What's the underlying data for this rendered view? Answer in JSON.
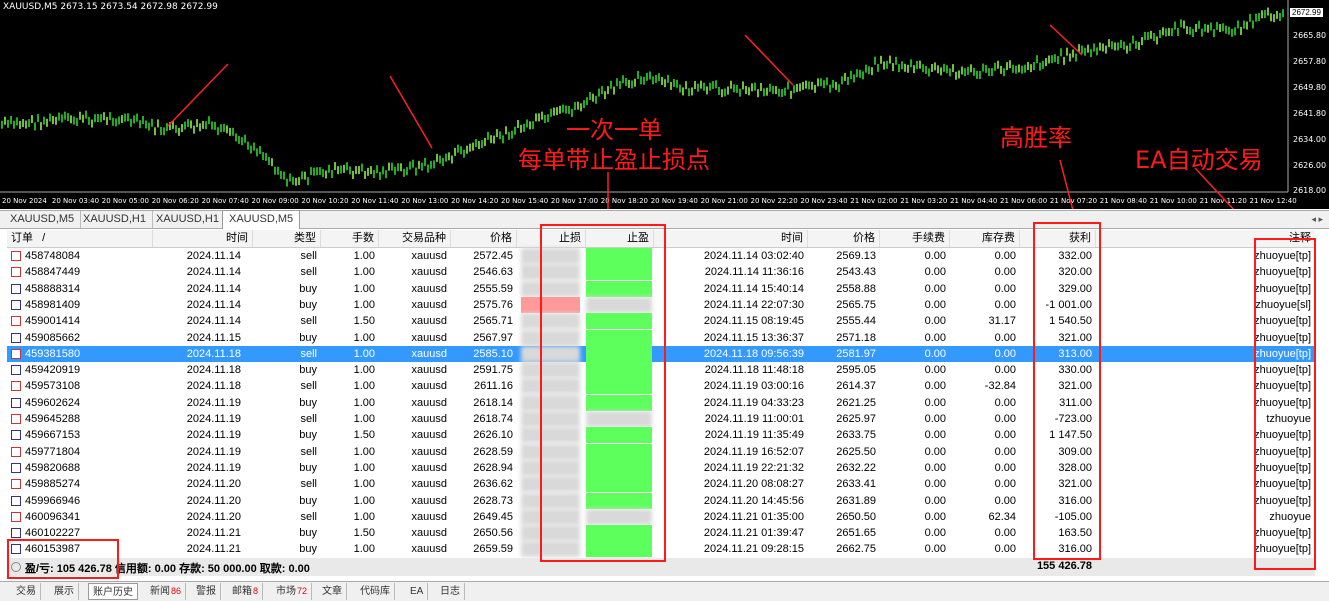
{
  "chart": {
    "title": "XAUUSD,M5  2673.15 2673.54 2672.98 2672.99",
    "current_price": "2672.99",
    "price_ticks": [
      "2665.80",
      "2657.80",
      "2649.80",
      "2641.80",
      "2634.00",
      "2626.00",
      "2618.00"
    ],
    "time_ticks": [
      "20 Nov 2024",
      "20 Nov 03:40",
      "20 Nov 05:00",
      "20 Nov 06:20",
      "20 Nov 07:40",
      "20 Nov 09:00",
      "20 Nov 10:20",
      "20 Nov 11:40",
      "20 Nov 13:00",
      "20 Nov 14:20",
      "20 Nov 15:40",
      "20 Nov 17:00",
      "20 Nov 18:20",
      "20 Nov 19:40",
      "20 Nov 21:00",
      "20 Nov 22:20",
      "20 Nov 23:40",
      "21 Nov 02:00",
      "21 Nov 03:20",
      "21 Nov 04:40",
      "21 Nov 06:00",
      "21 Nov 07:20",
      "21 Nov 08:40",
      "21 Nov 10:00",
      "21 Nov 11:20",
      "21 Nov 12:40"
    ],
    "annotations": {
      "line1": "一次一单",
      "line2": "每单带止盈止损点",
      "win_rate": "高胜率",
      "ea": "EA自动交易"
    },
    "accent": "#ff1a1a"
  },
  "chart_tabs": [
    "XAUUSD,M5",
    "XAUUSD,H1",
    "XAUUSD,H1",
    "XAUUSD,M5"
  ],
  "table": {
    "headers": {
      "order": "订单",
      "sort": "/",
      "time": "时间",
      "type": "类型",
      "lots": "手数",
      "symbol": "交易品种",
      "price": "价格",
      "sl": "止损",
      "tp": "止盈",
      "close_time": "时间",
      "close_price": "价格",
      "commission": "手续费",
      "swap": "库存费",
      "profit": "获利",
      "comment": "注释"
    },
    "rows": [
      {
        "order": "458748084",
        "time": "2024.11.14",
        "type": "sell",
        "lots": "1.00",
        "symbol": "xauusd",
        "price": "2572.45",
        "close_time": "2024.11.14 03:02:40",
        "close_price": "2569.13",
        "commission": "0.00",
        "swap": "0.00",
        "profit": "332.00",
        "comment": "zhuoyue[tp]",
        "result": "tp"
      },
      {
        "order": "458847449",
        "time": "2024.11.14",
        "type": "sell",
        "lots": "1.00",
        "symbol": "xauusd",
        "price": "2546.63",
        "close_time": "2024.11.14 11:36:16",
        "close_price": "2543.43",
        "commission": "0.00",
        "swap": "0.00",
        "profit": "320.00",
        "comment": "zhuoyue[tp]",
        "result": "tp"
      },
      {
        "order": "458888314",
        "time": "2024.11.14",
        "type": "buy",
        "lots": "1.00",
        "symbol": "xauusd",
        "price": "2555.59",
        "close_time": "2024.11.14 15:40:14",
        "close_price": "2558.88",
        "commission": "0.00",
        "swap": "0.00",
        "profit": "329.00",
        "comment": "zhuoyue[tp]",
        "result": "tp"
      },
      {
        "order": "458981409",
        "time": "2024.11.14",
        "type": "buy",
        "lots": "1.00",
        "symbol": "xauusd",
        "price": "2575.76",
        "close_time": "2024.11.14 22:07:30",
        "close_price": "2565.75",
        "commission": "0.00",
        "swap": "0.00",
        "profit": "-1 001.00",
        "comment": "zhuoyue[sl]",
        "result": "sl"
      },
      {
        "order": "459001414",
        "time": "2024.11.14",
        "type": "sell",
        "lots": "1.50",
        "symbol": "xauusd",
        "price": "2565.71",
        "close_time": "2024.11.15 08:19:45",
        "close_price": "2555.44",
        "commission": "0.00",
        "swap": "31.17",
        "profit": "1 540.50",
        "comment": "zhuoyue[tp]",
        "result": "tp"
      },
      {
        "order": "459085662",
        "time": "2024.11.15",
        "type": "buy",
        "lots": "1.00",
        "symbol": "xauusd",
        "price": "2567.97",
        "close_time": "2024.11.15 13:36:37",
        "close_price": "2571.18",
        "commission": "0.00",
        "swap": "0.00",
        "profit": "321.00",
        "comment": "zhuoyue[tp]",
        "result": "tp"
      },
      {
        "order": "459381580",
        "time": "2024.11.18",
        "type": "sell",
        "lots": "1.00",
        "symbol": "xauusd",
        "price": "2585.10",
        "close_time": "2024.11.18 09:56:39",
        "close_price": "2581.97",
        "commission": "0.00",
        "swap": "0.00",
        "profit": "313.00",
        "comment": "zhuoyue[tp]",
        "result": "tp",
        "selected": true
      },
      {
        "order": "459420919",
        "time": "2024.11.18",
        "type": "buy",
        "lots": "1.00",
        "symbol": "xauusd",
        "price": "2591.75",
        "close_time": "2024.11.18 11:48:18",
        "close_price": "2595.05",
        "commission": "0.00",
        "swap": "0.00",
        "profit": "330.00",
        "comment": "zhuoyue[tp]",
        "result": "tp"
      },
      {
        "order": "459573108",
        "time": "2024.11.18",
        "type": "sell",
        "lots": "1.00",
        "symbol": "xauusd",
        "price": "2611.16",
        "close_time": "2024.11.19 03:00:16",
        "close_price": "2614.37",
        "commission": "0.00",
        "swap": "-32.84",
        "profit": "321.00",
        "comment": "zhuoyue[tp]",
        "result": "tp"
      },
      {
        "order": "459602624",
        "time": "2024.11.19",
        "type": "buy",
        "lots": "1.00",
        "symbol": "xauusd",
        "price": "2618.14",
        "close_time": "2024.11.19 04:33:23",
        "close_price": "2621.25",
        "commission": "0.00",
        "swap": "0.00",
        "profit": "311.00",
        "comment": "zhuoyue[tp]",
        "result": "tp"
      },
      {
        "order": "459645288",
        "time": "2024.11.19",
        "type": "sell",
        "lots": "1.00",
        "symbol": "xauusd",
        "price": "2618.74",
        "close_time": "2024.11.19 11:00:01",
        "close_price": "2625.97",
        "commission": "0.00",
        "swap": "0.00",
        "profit": "-723.00",
        "comment": "tzhuoyue",
        "result": "none"
      },
      {
        "order": "459667153",
        "time": "2024.11.19",
        "type": "buy",
        "lots": "1.50",
        "symbol": "xauusd",
        "price": "2626.10",
        "close_time": "2024.11.19 11:35:49",
        "close_price": "2633.75",
        "commission": "0.00",
        "swap": "0.00",
        "profit": "1 147.50",
        "comment": "zhuoyue[tp]",
        "result": "tp"
      },
      {
        "order": "459771804",
        "time": "2024.11.19",
        "type": "sell",
        "lots": "1.00",
        "symbol": "xauusd",
        "price": "2628.59",
        "close_time": "2024.11.19 16:52:07",
        "close_price": "2625.50",
        "commission": "0.00",
        "swap": "0.00",
        "profit": "309.00",
        "comment": "zhuoyue[tp]",
        "result": "tp"
      },
      {
        "order": "459820688",
        "time": "2024.11.19",
        "type": "buy",
        "lots": "1.00",
        "symbol": "xauusd",
        "price": "2628.94",
        "close_time": "2024.11.19 22:21:32",
        "close_price": "2632.22",
        "commission": "0.00",
        "swap": "0.00",
        "profit": "328.00",
        "comment": "zhuoyue[tp]",
        "result": "tp"
      },
      {
        "order": "459885274",
        "time": "2024.11.20",
        "type": "sell",
        "lots": "1.00",
        "symbol": "xauusd",
        "price": "2636.62",
        "close_time": "2024.11.20 08:08:27",
        "close_price": "2633.41",
        "commission": "0.00",
        "swap": "0.00",
        "profit": "321.00",
        "comment": "zhuoyue[tp]",
        "result": "tp"
      },
      {
        "order": "459966946",
        "time": "2024.11.20",
        "type": "buy",
        "lots": "1.00",
        "symbol": "xauusd",
        "price": "2628.73",
        "close_time": "2024.11.20 14:45:56",
        "close_price": "2631.89",
        "commission": "0.00",
        "swap": "0.00",
        "profit": "316.00",
        "comment": "zhuoyue[tp]",
        "result": "tp"
      },
      {
        "order": "460096341",
        "time": "2024.11.20",
        "type": "sell",
        "lots": "1.00",
        "symbol": "xauusd",
        "price": "2649.45",
        "close_time": "2024.11.21 01:35:00",
        "close_price": "2650.50",
        "commission": "0.00",
        "swap": "62.34",
        "profit": "-105.00",
        "comment": "zhuoyue",
        "result": "none"
      },
      {
        "order": "460102227",
        "time": "2024.11.21",
        "type": "buy",
        "lots": "1.50",
        "symbol": "xauusd",
        "price": "2650.56",
        "close_time": "2024.11.21 01:39:47",
        "close_price": "2651.65",
        "commission": "0.00",
        "swap": "0.00",
        "profit": "163.50",
        "comment": "zhuoyue[tp]",
        "result": "tp"
      },
      {
        "order": "460153987",
        "time": "2024.11.21",
        "type": "buy",
        "lots": "1.00",
        "symbol": "xauusd",
        "price": "2659.59",
        "close_time": "2024.11.21 09:28:15",
        "close_price": "2662.75",
        "commission": "0.00",
        "swap": "0.00",
        "profit": "316.00",
        "comment": "zhuoyue[tp]",
        "result": "tp"
      }
    ],
    "total": {
      "summary": "盈/亏: 105 426.78  信用额: 0.00  存款: 50 000.00  取款: 0.00",
      "profit": "155 426.78"
    }
  },
  "bottom_tabs": [
    {
      "label": "交易",
      "badge": ""
    },
    {
      "label": "展示",
      "badge": ""
    },
    {
      "label": "账户历史",
      "badge": ""
    },
    {
      "label": "新闻",
      "badge": "86"
    },
    {
      "label": "警报",
      "badge": ""
    },
    {
      "label": "邮箱",
      "badge": "8"
    },
    {
      "label": "市场",
      "badge": "72"
    },
    {
      "label": "文章",
      "badge": ""
    },
    {
      "label": "代码库",
      "badge": ""
    },
    {
      "label": "EA",
      "badge": ""
    },
    {
      "label": "日志",
      "badge": ""
    }
  ]
}
